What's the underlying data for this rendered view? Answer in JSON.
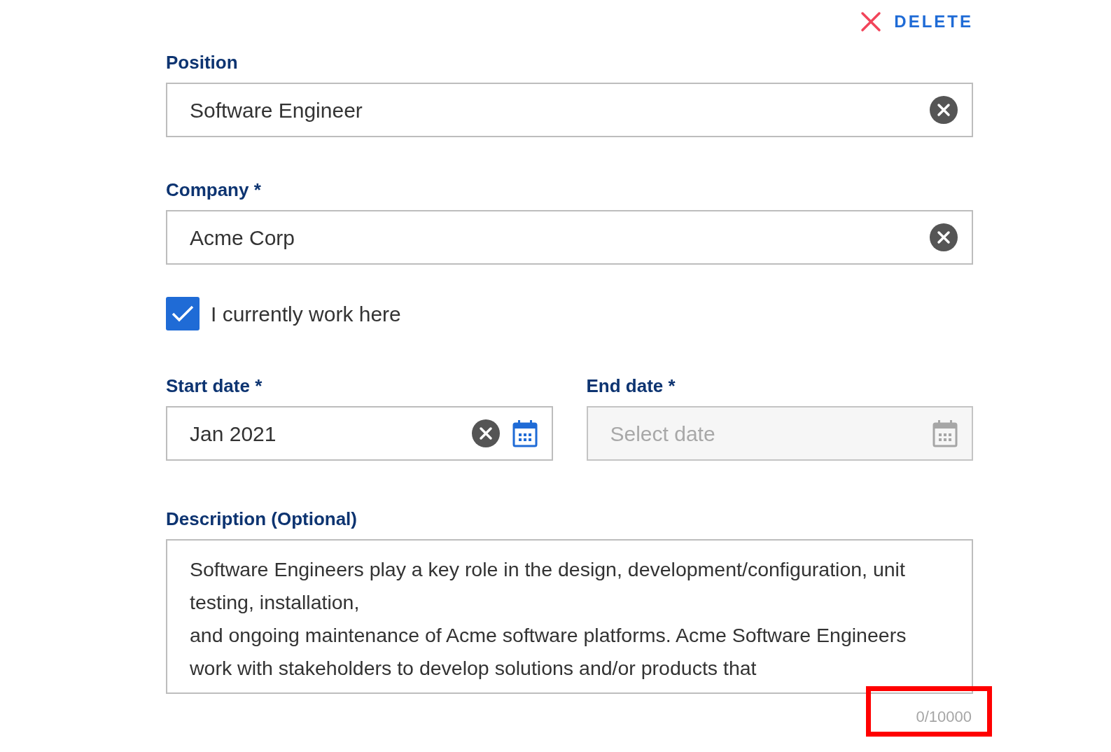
{
  "delete_button": {
    "label": "DELETE"
  },
  "position": {
    "label": "Position",
    "value": "Software Engineer",
    "clearable": true
  },
  "company": {
    "label": "Company *",
    "value": "Acme Corp",
    "clearable": true
  },
  "current_job": {
    "label": "I currently work here",
    "checked": true
  },
  "start_date": {
    "label": "Start date *",
    "value": "Jan 2021",
    "clearable": true,
    "disabled": false
  },
  "end_date": {
    "label": "End date *",
    "placeholder": "Select date",
    "clearable": false,
    "disabled": true
  },
  "description": {
    "label": "Description (Optional)",
    "value": "Software Engineers play a key role in the design, development/configuration, unit testing, installation,\nand ongoing maintenance of Acme software platforms. Acme Software Engineers work with stakeholders to develop solutions and/or products that"
  },
  "counter": {
    "text": "0/10000",
    "highlighted": true
  }
}
